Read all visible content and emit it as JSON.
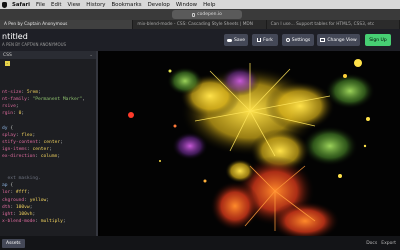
{
  "menubar": {
    "app": "Safari",
    "items": [
      "File",
      "Edit",
      "View",
      "History",
      "Bookmarks",
      "Develop",
      "Window",
      "Help"
    ]
  },
  "browser": {
    "url": "codepen.io",
    "tabs": [
      {
        "label": "A Pen by Captain Anonymous",
        "active": true
      },
      {
        "label": "mix-blend-mode - CSS: Cascading Style Sheets | MDN",
        "active": false
      },
      {
        "label": "Can I use... Support tables for HTML5, CSS3, etc",
        "active": false
      }
    ]
  },
  "codepen": {
    "title": "ntitled",
    "author": "A PEN BY CAPTAIN ANONYMOUS",
    "buttons": {
      "save": "Save",
      "fork": "Fork",
      "settings": "Settings",
      "change_view": "Change View",
      "signup": "Sign Up"
    },
    "signup_color": "#47cf73"
  },
  "editor": {
    "title": "CSS"
  },
  "bottom": {
    "left_button": "Assets",
    "right_items": [
      "Docs",
      "Export"
    ]
  }
}
